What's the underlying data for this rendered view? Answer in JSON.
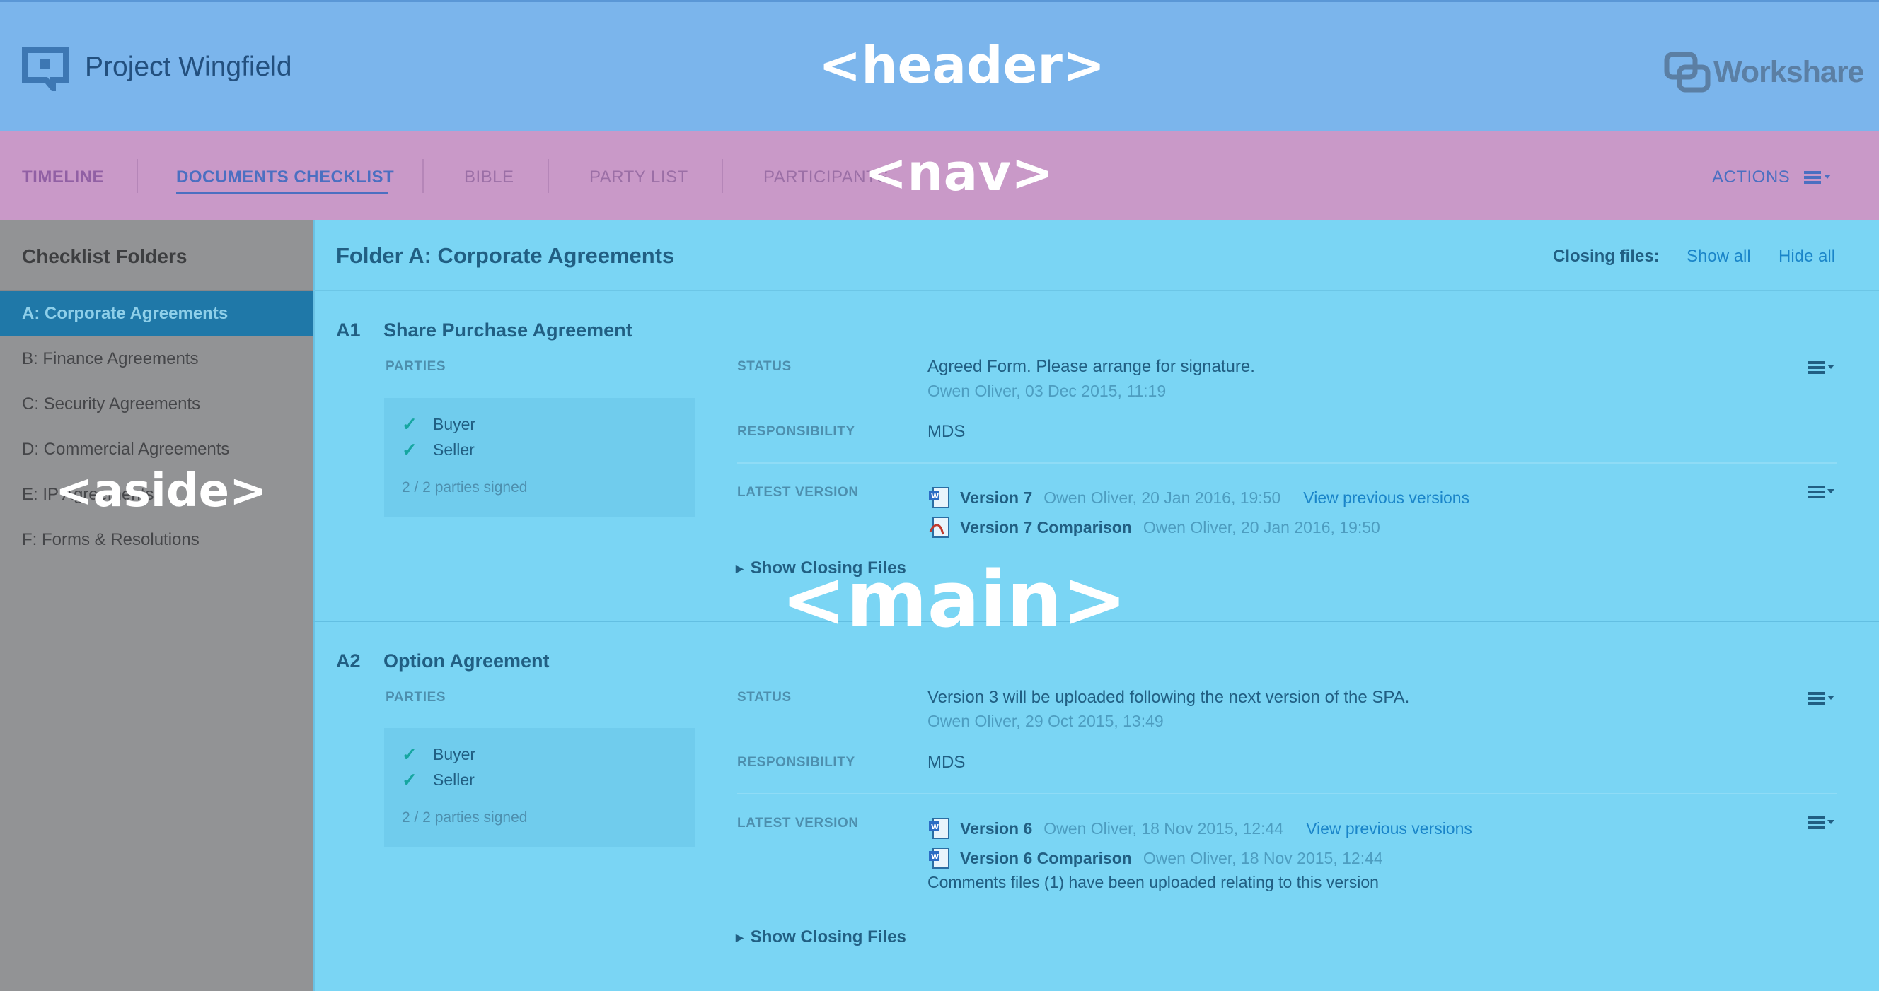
{
  "header": {
    "project_title": "Project Wingfield",
    "brand": "Workshare",
    "region_label": "<header>"
  },
  "nav": {
    "items": [
      {
        "label": "TIMELINE"
      },
      {
        "label": "DOCUMENTS CHECKLIST",
        "active": true
      },
      {
        "label": "BIBLE"
      },
      {
        "label": "PARTY LIST"
      },
      {
        "label": "PARTICIPANTS"
      }
    ],
    "actions_label": "ACTIONS",
    "region_label": "<nav>"
  },
  "aside": {
    "title": "Checklist Folders",
    "folders": [
      {
        "label": "A: Corporate Agreements",
        "selected": true
      },
      {
        "label": "B: Finance Agreements"
      },
      {
        "label": "C: Security Agreements"
      },
      {
        "label": "D: Commercial Agreements"
      },
      {
        "label": "E: IP Agreements"
      },
      {
        "label": "F: Forms & Resolutions"
      }
    ],
    "region_label": "<aside>"
  },
  "main": {
    "title": "Folder A: Corporate Agreements",
    "closing_files_label": "Closing files:",
    "show_all": "Show all",
    "hide_all": "Hide all",
    "region_label": "<main>",
    "labels": {
      "parties": "PARTIES",
      "status": "STATUS",
      "responsibility": "RESPONSIBILITY",
      "latest_version": "LATEST VERSION",
      "show_closing_files": "Show Closing Files"
    },
    "items": [
      {
        "code": "A1",
        "title": "Share Purchase Agreement",
        "parties": [
          "Buyer",
          "Seller"
        ],
        "signed": "2 / 2 parties signed",
        "status": "Agreed Form. Please arrange for signature.",
        "status_meta": "Owen Oliver, 03 Dec 2015, 11:19",
        "responsibility": "MDS",
        "versions": [
          {
            "name": "Version 7",
            "meta": "Owen Oliver, 20 Jan 2016, 19:50",
            "link": "View previous versions",
            "icon": "word-doc-icon"
          },
          {
            "name": "Version 7 Comparison",
            "meta": "Owen Oliver, 20 Jan 2016, 19:50",
            "icon": "pdf-doc-icon"
          }
        ]
      },
      {
        "code": "A2",
        "title": "Option Agreement",
        "parties": [
          "Buyer",
          "Seller"
        ],
        "signed": "2 / 2 parties signed",
        "status": "Version 3 will be uploaded following the next version of the SPA.",
        "status_meta": "Owen Oliver, 29 Oct 2015, 13:49",
        "responsibility": "MDS",
        "versions": [
          {
            "name": "Version 6",
            "meta": "Owen Oliver, 18 Nov 2015, 12:44",
            "link": "View previous versions",
            "icon": "word-doc-icon"
          },
          {
            "name": "Version 6 Comparison",
            "meta": "Owen Oliver, 18 Nov 2015, 12:44",
            "icon": "word-doc-icon"
          }
        ],
        "note": "Comments files (1) have been uploaded relating to this version"
      }
    ]
  },
  "colors": {
    "header_bg": "#7bb5ec",
    "nav_bg": "#c999c8",
    "aside_bg": "#929395",
    "main_bg": "#7ad5f4",
    "link": "#1a85c9",
    "check": "#16a6a0"
  }
}
